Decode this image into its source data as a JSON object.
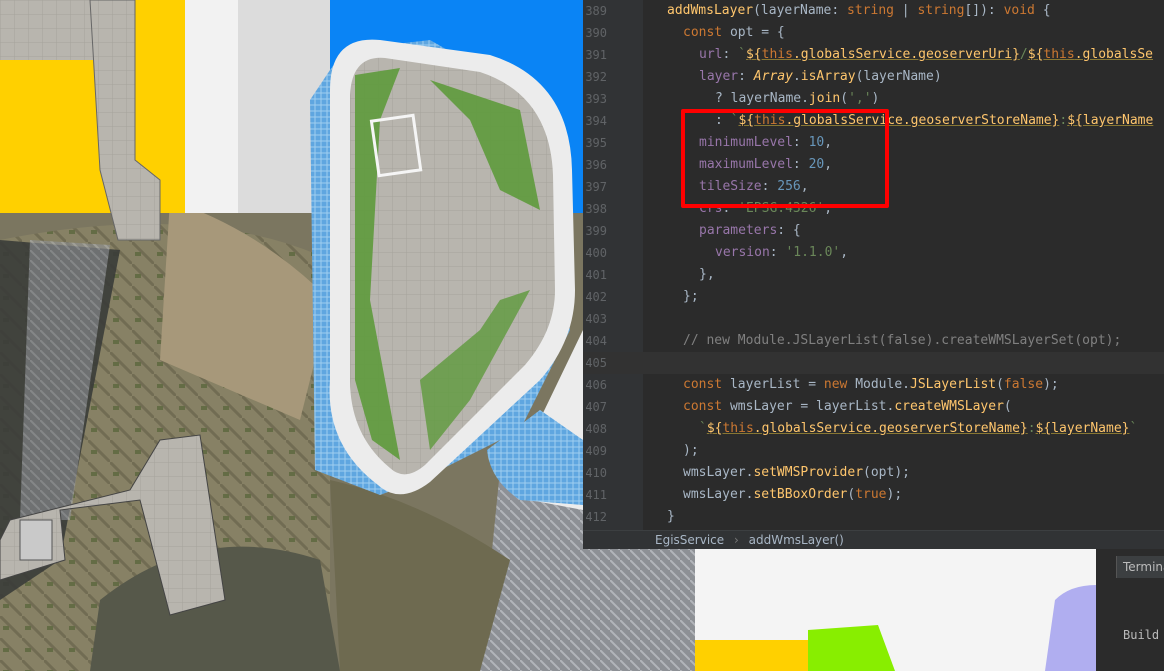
{
  "editor": {
    "lines": [
      {
        "num": "389",
        "html": "<span class='fn'>addWmsLayer</span>(layerName: <span class='kw'>string</span> | <span class='kw'>string</span>[]): <span class='kw'>void</span> {",
        "indent": 0
      },
      {
        "num": "390",
        "html": "<span class='kw'>const</span> opt = {",
        "indent": 1
      },
      {
        "num": "391",
        "html": "<span class='prop'>url</span>: <span class='str'>`</span><span class='tmpl'>${<span class='kw'>this</span>.globalsService.geoserverUri}</span><span class='str'>/</span><span class='tmpl'>${<span class='kw'>this</span>.globalsSe</span>",
        "indent": 2
      },
      {
        "num": "392",
        "html": "<span class='prop'>layer</span>: <span class='fn'><i>Array</i></span>.<span class='fn'>isArray</span>(layerName)",
        "indent": 2
      },
      {
        "num": "393",
        "html": "? layerName.<span class='fn'>join</span>(<span class='str'>','</span>)",
        "indent": 3
      },
      {
        "num": "394",
        "html": ": <span class='str'>`</span><span class='tmpl'>${<span class='kw'>this</span>.globalsService.geoserverStoreName}</span><span class='str'>:</span><span class='tmpl'>${layerName</span>",
        "indent": 3
      },
      {
        "num": "395",
        "html": "<span class='prop'>minimumLevel</span>: <span class='num'>10</span>,",
        "indent": 2
      },
      {
        "num": "396",
        "html": "<span class='prop'>maximumLevel</span>: <span class='num'>20</span>,",
        "indent": 2
      },
      {
        "num": "397",
        "html": "<span class='prop'>tileSize</span>: <span class='num'>256</span>,",
        "indent": 2
      },
      {
        "num": "398",
        "html": "<span class='prop'>crs</span>: <span class='str'>'EPSG:4326'</span>,",
        "indent": 2
      },
      {
        "num": "399",
        "html": "<span class='prop'>parameters</span>: {",
        "indent": 2
      },
      {
        "num": "400",
        "html": "<span class='prop'>version</span>: <span class='str'>'1.1.0'</span>,",
        "indent": 3
      },
      {
        "num": "401",
        "html": "},",
        "indent": 2
      },
      {
        "num": "402",
        "html": "};",
        "indent": 1
      },
      {
        "num": "403",
        "html": "",
        "indent": 0
      },
      {
        "num": "404",
        "html": "<span class='cm'>// new Module.JSLayerList(false).createWMSLayerSet(opt);</span>",
        "indent": 1
      },
      {
        "num": "405",
        "html": "",
        "indent": 0,
        "current": true
      },
      {
        "num": "406",
        "html": "<span class='kw'>const</span> layerList = <span class='kw'>new</span> Module.<span class='fn'>JSLayerList</span>(<span class='kw'>false</span>);",
        "indent": 1
      },
      {
        "num": "407",
        "html": "<span class='kw'>const</span> wmsLayer = layerList.<span class='fn'>createWMSLayer</span>(",
        "indent": 1
      },
      {
        "num": "408",
        "html": "<span class='str'>`</span><span class='tmpl'>${<span class='kw'>this</span>.globalsService.geoserverStoreName}</span><span class='str'>:</span><span class='tmpl'>${layerName}</span><span class='str'>`</span>",
        "indent": 2
      },
      {
        "num": "409",
        "html": ");",
        "indent": 1
      },
      {
        "num": "410",
        "html": "wmsLayer.<span class='fn'>setWMSProvider</span>(opt);",
        "indent": 1
      },
      {
        "num": "411",
        "html": "wmsLayer.<span class='fn'>setBBoxOrder</span>(<span class='kw'>true</span>);",
        "indent": 1
      },
      {
        "num": "412",
        "html": "}",
        "indent": 0
      }
    ],
    "breadcrumb": {
      "class_name": "EgisService",
      "separator": "›",
      "method_name": "addWmsLayer()"
    },
    "highlight_color": "#ff0000"
  },
  "terminal": {
    "tab_label": "Termina",
    "output": "Build"
  },
  "colors": {
    "sky": "#0a84f5",
    "yellow": "#ffd000",
    "editor_bg": "#2b2b2b"
  }
}
